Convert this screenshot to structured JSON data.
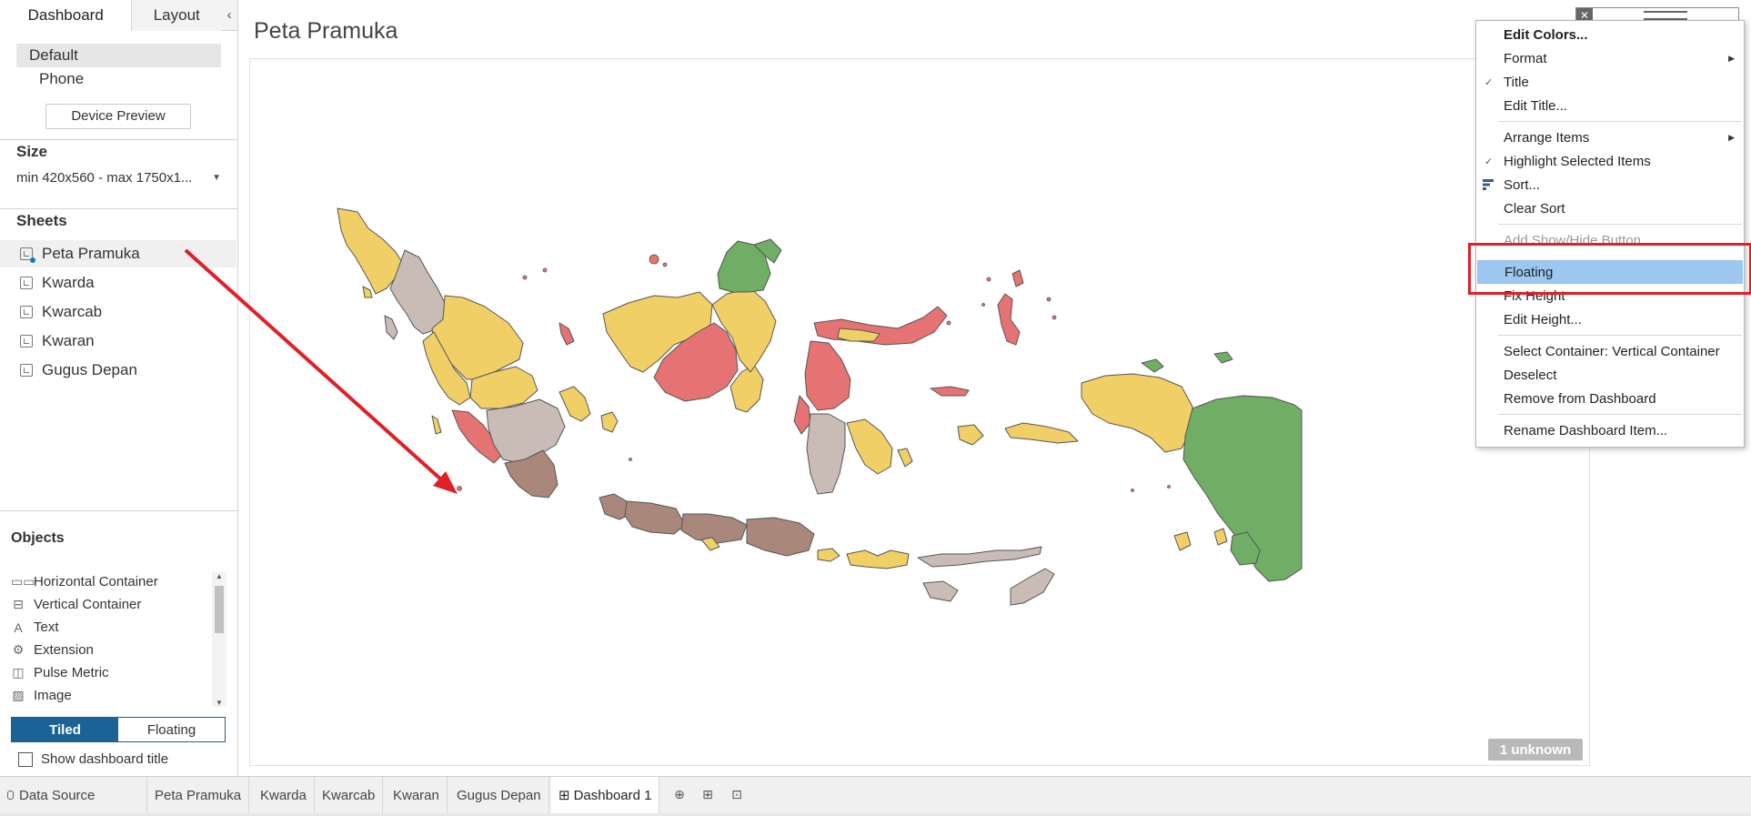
{
  "left_panel": {
    "tabs": {
      "dashboard": "Dashboard",
      "layout": "Layout",
      "collapse_glyph": "‹"
    },
    "devices": [
      "Default",
      "Phone"
    ],
    "device_preview_label": "Device Preview",
    "size_title": "Size",
    "size_value": "min 420x560 - max 1750x1...",
    "sheets_title": "Sheets",
    "sheets": [
      "Peta Pramuka",
      "Kwarda",
      "Kwarcab",
      "Kwaran",
      "Gugus Depan"
    ],
    "objects_title": "Objects",
    "objects": [
      {
        "label": "Horizontal Container",
        "icon": "horizontal-container-icon"
      },
      {
        "label": "Vertical Container",
        "icon": "vertical-container-icon"
      },
      {
        "label": "Text",
        "icon": "text-icon"
      },
      {
        "label": "Extension",
        "icon": "extension-icon"
      },
      {
        "label": "Pulse Metric",
        "icon": "pulse-metric-icon"
      },
      {
        "label": "Image",
        "icon": "image-icon"
      }
    ],
    "tiled_label": "Tiled",
    "floating_label": "Floating",
    "show_title_label": "Show dashboard title"
  },
  "dashboard": {
    "title": "Peta Pramuka",
    "unknown_badge": "1 unknown",
    "region_colors": {
      "yellow": "#f0d066",
      "red": "#e57373",
      "green": "#6fae64",
      "brown": "#a9877a",
      "gray": "#c9bcb7"
    }
  },
  "container_toolbar": {
    "close_glyph": "✕"
  },
  "context_menu": {
    "items": [
      {
        "label": "Edit Colors...",
        "bold": true
      },
      {
        "label": "Format",
        "submenu": true
      },
      {
        "label": "Title",
        "checked": true
      },
      {
        "label": "Edit Title..."
      },
      {
        "label": "Arrange Items",
        "submenu": true
      },
      {
        "label": "Highlight Selected Items",
        "checked": true
      },
      {
        "label": "Sort...",
        "icon": "sort-icon"
      },
      {
        "label": "Clear Sort"
      },
      {
        "label": "Add Show/Hide Button",
        "disabled": true
      },
      {
        "label": "Floating",
        "highlighted": true
      },
      {
        "label": "Fix Height"
      },
      {
        "label": "Edit Height..."
      },
      {
        "label": "Select Container: Vertical Container"
      },
      {
        "label": "Deselect"
      },
      {
        "label": "Remove from Dashboard"
      },
      {
        "label": "Rename Dashboard Item..."
      }
    ],
    "highlight_color": "#9bc7f0",
    "callout_color": "#e01f26"
  },
  "bottom_tabs": {
    "data_source": "Data Source",
    "sheets": [
      "Peta Pramuka",
      "Kwarda",
      "Kwarcab",
      "Kwaran",
      "Gugus Depan"
    ],
    "active_dashboard": "Dashboard 1",
    "active_glyph": "⊞"
  }
}
